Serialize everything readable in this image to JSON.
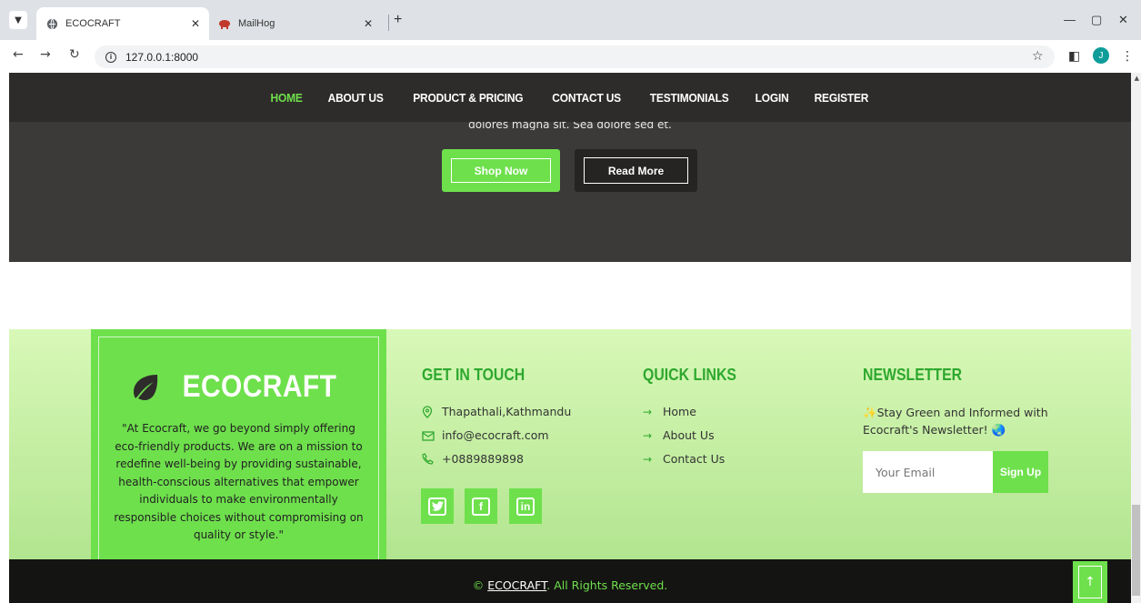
{
  "browser": {
    "tabs": [
      {
        "title": "ECOCRAFT",
        "active": true
      },
      {
        "title": "MailHog",
        "active": false
      }
    ],
    "url": "127.0.0.1:8000",
    "profile_initial": "J"
  },
  "navbar": {
    "items": [
      "HOME",
      "ABOUT US",
      "PRODUCT & PRICING",
      "CONTACT US",
      "TESTIMONIALS",
      "LOGIN",
      "REGISTER"
    ],
    "active_index": 0
  },
  "hero": {
    "partial_text": "dolores magna sit. Sea dolore sed et.",
    "shop_label": "Shop Now",
    "read_label": "Read More"
  },
  "footer": {
    "brand": {
      "name": "ECOCRAFT",
      "description": "\"At Ecocraft, we go beyond simply offering eco-friendly products. We are on a mission to redefine well-being by providing sustainable, health-conscious alternatives that empower individuals to make environmentally responsible choices without compromising on quality or style.\""
    },
    "contact": {
      "title": "GET IN TOUCH",
      "address": "Thapathali,Kathmandu",
      "email": "info@ecocraft.com",
      "phone": "+0889889898"
    },
    "social": [
      "twitter-icon",
      "facebook-icon",
      "linkedin-icon"
    ],
    "quick_links": {
      "title": "QUICK LINKS",
      "items": [
        "Home",
        "About Us",
        "Contact Us"
      ]
    },
    "newsletter": {
      "title": "NEWSLETTER",
      "text": "✨Stay Green and Informed with Ecocraft's Newsletter! 🌏",
      "placeholder": "Your Email",
      "button": "Sign Up"
    },
    "copyright": {
      "brand": "ECOCRAFT",
      "rest": ". All Rights Reserved."
    }
  },
  "colors": {
    "accent": "#6ee04c",
    "title_green": "#2ea82e",
    "dark": "#2e2c2a"
  }
}
